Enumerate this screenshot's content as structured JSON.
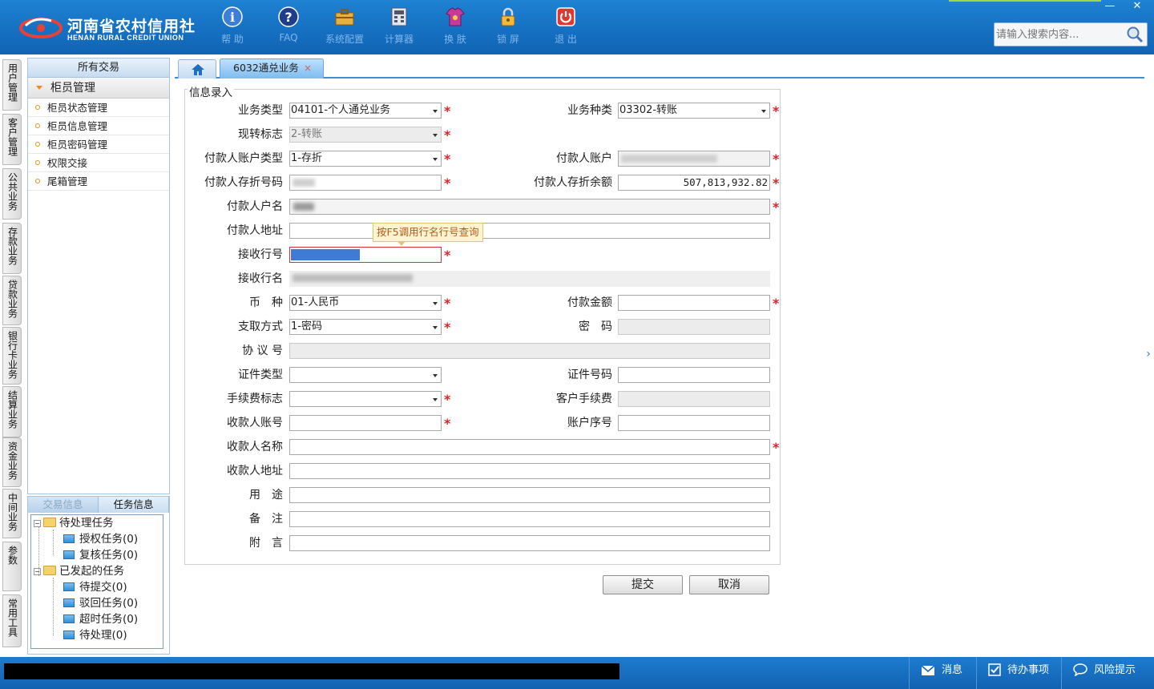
{
  "header": {
    "logo_cn": "河南省农村信用社",
    "logo_en": "HENAN RURAL CREDIT UNION",
    "toolbar": [
      {
        "label": "帮 助",
        "icon": "help-icon"
      },
      {
        "label": "FAQ",
        "icon": "faq-icon"
      },
      {
        "label": "系统配置",
        "icon": "toolbox-icon"
      },
      {
        "label": "计算器",
        "icon": "calculator-icon"
      },
      {
        "label": "换 肤",
        "icon": "skin-icon"
      },
      {
        "label": "锁 屏",
        "icon": "lock-icon"
      },
      {
        "label": "退 出",
        "icon": "power-icon"
      }
    ],
    "window_controls": {
      "minimize": "—",
      "close": "✕"
    },
    "search": {
      "placeholder": "请输入搜索内容..."
    }
  },
  "vtabs": [
    "用户管理",
    "客户管理",
    "公共业务",
    "存款业务",
    "贷款业务",
    "银行卡业务",
    "结算业务",
    "资金业务",
    "中间业务",
    "参数",
    "常用工具"
  ],
  "nav": {
    "header": "所有交易",
    "group": "柜员管理",
    "items": [
      "柜员状态管理",
      "柜员信息管理",
      "柜员密码管理",
      "权限交接",
      "尾箱管理"
    ]
  },
  "tasks": {
    "tabs": [
      "交易信息",
      "任务信息"
    ],
    "pending_group": "待处理任务",
    "pending": [
      "授权任务(0)",
      "复核任务(0)"
    ],
    "initiated_group": "已发起的任务",
    "initiated": [
      "待提交(0)",
      "驳回任务(0)",
      "超时任务(0)",
      "待处理(0)"
    ]
  },
  "tabs": {
    "active": "6032通兑业务",
    "close": "×"
  },
  "form": {
    "title": "信息录入",
    "labels": {
      "biz_type": "业务类型",
      "biz_kind": "业务种类",
      "cash_transfer": "现转标志",
      "payer_acct_type": "付款人账户类型",
      "payer_acct": "付款人账户",
      "payer_book_no": "付款人存折号码",
      "payer_balance": "付款人存折余额",
      "payer_name": "付款人户名",
      "payer_addr": "付款人地址",
      "recv_bank_no": "接收行号",
      "recv_bank_name": "接收行名",
      "currency": "币　种",
      "amount": "付款金额",
      "withdraw_method": "支取方式",
      "password": "密　码",
      "agreement_no": "协 议 号",
      "id_type": "证件类型",
      "id_no": "证件号码",
      "fee_flag": "手续费标志",
      "customer_fee": "客户手续费",
      "payee_acct": "收款人账号",
      "acct_seq": "账户序号",
      "payee_name": "收款人名称",
      "payee_addr": "收款人地址",
      "purpose": "用　途",
      "remark": "备　注",
      "postscript": "附　言"
    },
    "values": {
      "biz_type": "04101-个人通兑业务",
      "biz_kind": "03302-转账",
      "cash_transfer": "2-转账",
      "payer_acct_type": "1-存折",
      "payer_balance": "507,813,932.82",
      "currency": "01-人民币",
      "withdraw_method": "1-密码"
    },
    "required_mark": "*",
    "tooltip": "按F5调用行名行号查询",
    "submit": "提交",
    "cancel": "取消"
  },
  "statusbar": {
    "messages": "消息",
    "todo": "待办事项",
    "risk": "风险提示"
  }
}
